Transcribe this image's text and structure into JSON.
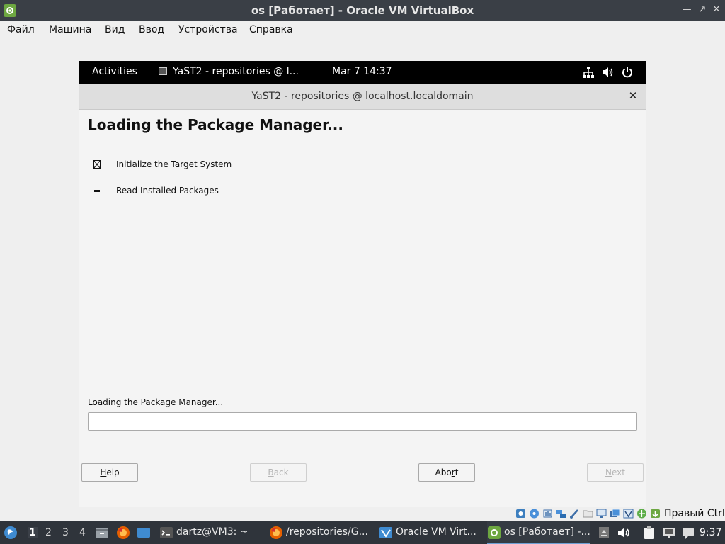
{
  "host_window": {
    "title": "os [Работает] - Oracle VM VirtualBox",
    "app_icon": "virtualbox-green-logo",
    "buttons": [
      "minimize",
      "restore",
      "close"
    ]
  },
  "host_menu": [
    "Файл",
    "Машина",
    "Вид",
    "Ввод",
    "Устройства",
    "Справка"
  ],
  "gnome_bar": {
    "activities": "Activities",
    "app_indicator": "YaST2 - repositories @ l...",
    "clock": "Mar 7  14:37",
    "tray_icons": [
      "network-icon",
      "volume-icon",
      "power-icon"
    ]
  },
  "yast": {
    "window_title": "YaST2 - repositories @ localhost.localdomain",
    "heading": "Loading the Package Manager...",
    "steps": [
      {
        "label": "Initialize the Target System",
        "state": "done"
      },
      {
        "label": "Read Installed Packages",
        "state": "current"
      }
    ],
    "progress": {
      "label": "Loading the Package Manager...",
      "value": 0
    },
    "buttons": {
      "help": {
        "before": "",
        "key": "H",
        "after": "elp"
      },
      "back": {
        "before": "",
        "key": "B",
        "after": "ack"
      },
      "abort": {
        "before": "Abo",
        "key": "r",
        "after": "t"
      },
      "next": {
        "before": "",
        "key": "N",
        "after": "ext"
      }
    }
  },
  "vm_status": {
    "icons": [
      "hard-disk-icon",
      "optical-disk-icon",
      "audio-icon",
      "network-adapter-icon",
      "usb-icon",
      "shared-folder-icon",
      "display-icon",
      "video-capture-icon",
      "virtualization-icon",
      "cpu-icon",
      "mouse-integration-icon"
    ],
    "host_key": "Правый Ctrl"
  },
  "taskbar": {
    "workspaces": [
      "1",
      "2",
      "3",
      "4"
    ],
    "active_workspace": "1",
    "launchers": [
      "file-manager-icon",
      "firefox-icon",
      "blue-app-icon"
    ],
    "tasks": [
      {
        "label": "dartz@VM3: ~",
        "icon": "terminal-icon"
      },
      {
        "label": "/repositories/G...",
        "icon": "firefox-icon"
      },
      {
        "label": "Oracle VM Virt...",
        "icon": "virtualbox-icon"
      },
      {
        "label": "os [Работает] -...",
        "icon": "virtualbox-vm-icon",
        "active": true
      }
    ],
    "tray": [
      "eject-icon",
      "volume-icon",
      "clipboard-icon",
      "network-icon",
      "notification-icon"
    ],
    "time": "9:37"
  }
}
